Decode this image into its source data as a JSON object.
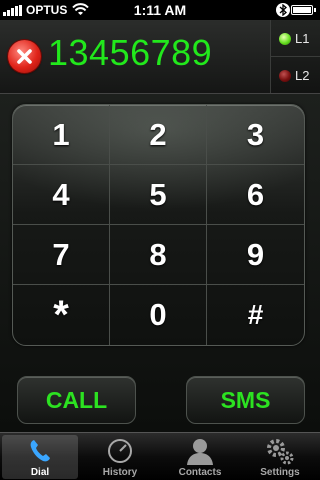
{
  "status_bar": {
    "carrier": "OPTUS",
    "time": "1:11 AM",
    "signal_icon": "signal-bars-icon",
    "wifi_icon": "wifi-icon",
    "bluetooth_icon": "bluetooth-icon",
    "battery_icon": "battery-icon"
  },
  "display": {
    "number": "13456789",
    "clear_icon": "clear-x-icon",
    "lines": [
      {
        "label": "L1",
        "status": "active",
        "led_color": "#66e020"
      },
      {
        "label": "L2",
        "status": "inactive",
        "led_color": "#7a1010"
      }
    ]
  },
  "keypad": {
    "keys": [
      "1",
      "2",
      "3",
      "4",
      "5",
      "6",
      "7",
      "8",
      "9",
      "*",
      "0",
      "#"
    ]
  },
  "actions": {
    "call_label": "CALL",
    "sms_label": "SMS",
    "accent_color": "#2ce221"
  },
  "tabbar": {
    "tabs": [
      {
        "label": "Dial",
        "icon": "phone-handset-icon",
        "active": true
      },
      {
        "label": "History",
        "icon": "clock-icon",
        "active": false
      },
      {
        "label": "Contacts",
        "icon": "person-silhouette-icon",
        "active": false
      },
      {
        "label": "Settings",
        "icon": "gears-icon",
        "active": false
      }
    ]
  }
}
